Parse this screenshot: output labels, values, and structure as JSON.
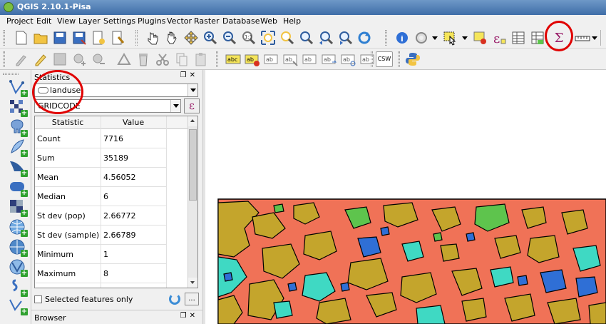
{
  "window": {
    "title": "QGIS 2.10.1-Pisa"
  },
  "menu": [
    "Project",
    "Edit",
    "View",
    "Layer",
    "Settings",
    "Plugins",
    "Vector",
    "Raster",
    "Database",
    "Web",
    "Help"
  ],
  "toolbar": {
    "csw_label": "CSW",
    "stats_label": "Σ"
  },
  "statistics_panel": {
    "title": "Statistics",
    "layer_value": "landuse",
    "field_value": "GRIDCODE",
    "expression_symbol": "ε",
    "headers": [
      "Statistic",
      "Value"
    ],
    "rows": [
      {
        "statistic": "Count",
        "value": "7716"
      },
      {
        "statistic": "Sum",
        "value": "35189"
      },
      {
        "statistic": "Mean",
        "value": "4.56052"
      },
      {
        "statistic": "Median",
        "value": "6"
      },
      {
        "statistic": "St dev (pop)",
        "value": "2.66772"
      },
      {
        "statistic": "St dev (sample)",
        "value": "2.66789"
      },
      {
        "statistic": "Minimum",
        "value": "1"
      },
      {
        "statistic": "Maximum",
        "value": "8"
      }
    ],
    "selected_only_label": "Selected features only",
    "more_label": "..."
  },
  "browser_panel": {
    "title": "Browser"
  },
  "colors": {
    "map_salmon": "#f07257",
    "map_olive": "#c4a52c",
    "map_cyan": "#3fd9c3",
    "map_blue": "#2f6fd6",
    "map_green": "#5ec44d",
    "highlight_circle": "#e00000"
  }
}
